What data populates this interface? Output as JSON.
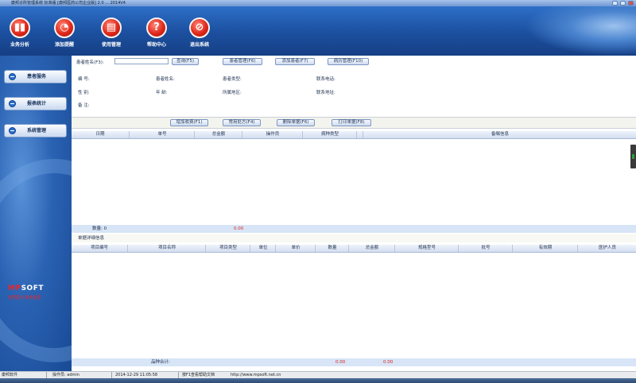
{
  "window": {
    "title": "康邦诊所管理系统 标准版 [康邦医药公司企业版] 2.0 ... 2014V4"
  },
  "toolbar": {
    "buttons": [
      {
        "label": "业务分析",
        "icon": "bar-chart-icon",
        "glyph": "▮▮"
      },
      {
        "label": "添加提醒",
        "icon": "clock-icon",
        "glyph": "◔"
      },
      {
        "label": "使用管理",
        "icon": "document-icon",
        "glyph": "▤"
      },
      {
        "label": "帮助中心",
        "icon": "help-icon",
        "glyph": "?"
      },
      {
        "label": "退出系统",
        "icon": "power-icon",
        "glyph": "⊘"
      }
    ]
  },
  "sidebar": {
    "items": [
      {
        "label": "患者服务"
      },
      {
        "label": "报表统计"
      },
      {
        "label": "系统管理"
      }
    ],
    "logo": {
      "brand_red": "MP",
      "brand_white": "SOFT",
      "slogan": "智慧医疗 服务基层"
    }
  },
  "search": {
    "name_label": "患者姓名(F3):",
    "name_value": "",
    "query_btn": "查询(F5)",
    "manage_btn": "患者管理(F6)",
    "add_btn": "添加患者(F7)",
    "history_btn": "病历管理(F10)",
    "fields": {
      "id": "编  号:",
      "patient_name": "患者姓名:",
      "patient_type": "患者类型:",
      "phone": "联系电话:",
      "gender": "性  别:",
      "age": "年  龄:",
      "region": "所属地区:",
      "address": "联系地址:",
      "remark": "备  注:"
    }
  },
  "actions": {
    "add_fee": "增加收费(F1)",
    "common_rx": "常用处方(F4)",
    "delete_order": "删除单据(F6)",
    "print_order": "打印单据(F8)"
  },
  "order_table": {
    "columns": [
      "日期",
      "单号",
      "总金额",
      "操作员",
      "病种类型",
      "",
      "备嘱信息"
    ],
    "count_label": "数量: 0",
    "total_value": "0.00"
  },
  "detail": {
    "section_label": "单据详细信息",
    "columns": [
      "项目编号",
      "项目名称",
      "项目类型",
      "单位",
      "单价",
      "数量",
      "总金额",
      "规格型号",
      "批号",
      "有效期",
      "医护人员"
    ],
    "sum_label": "品种合计:",
    "sum_value1": "0.00",
    "sum_value2": "0.00"
  },
  "statusbar": {
    "company": "康邦软件",
    "operator": "操作员: admin",
    "datetime": "2014-12-29 11:05:58",
    "help": "按F1查看帮助文档",
    "url": "http://www.mpsoft.net.cn"
  }
}
